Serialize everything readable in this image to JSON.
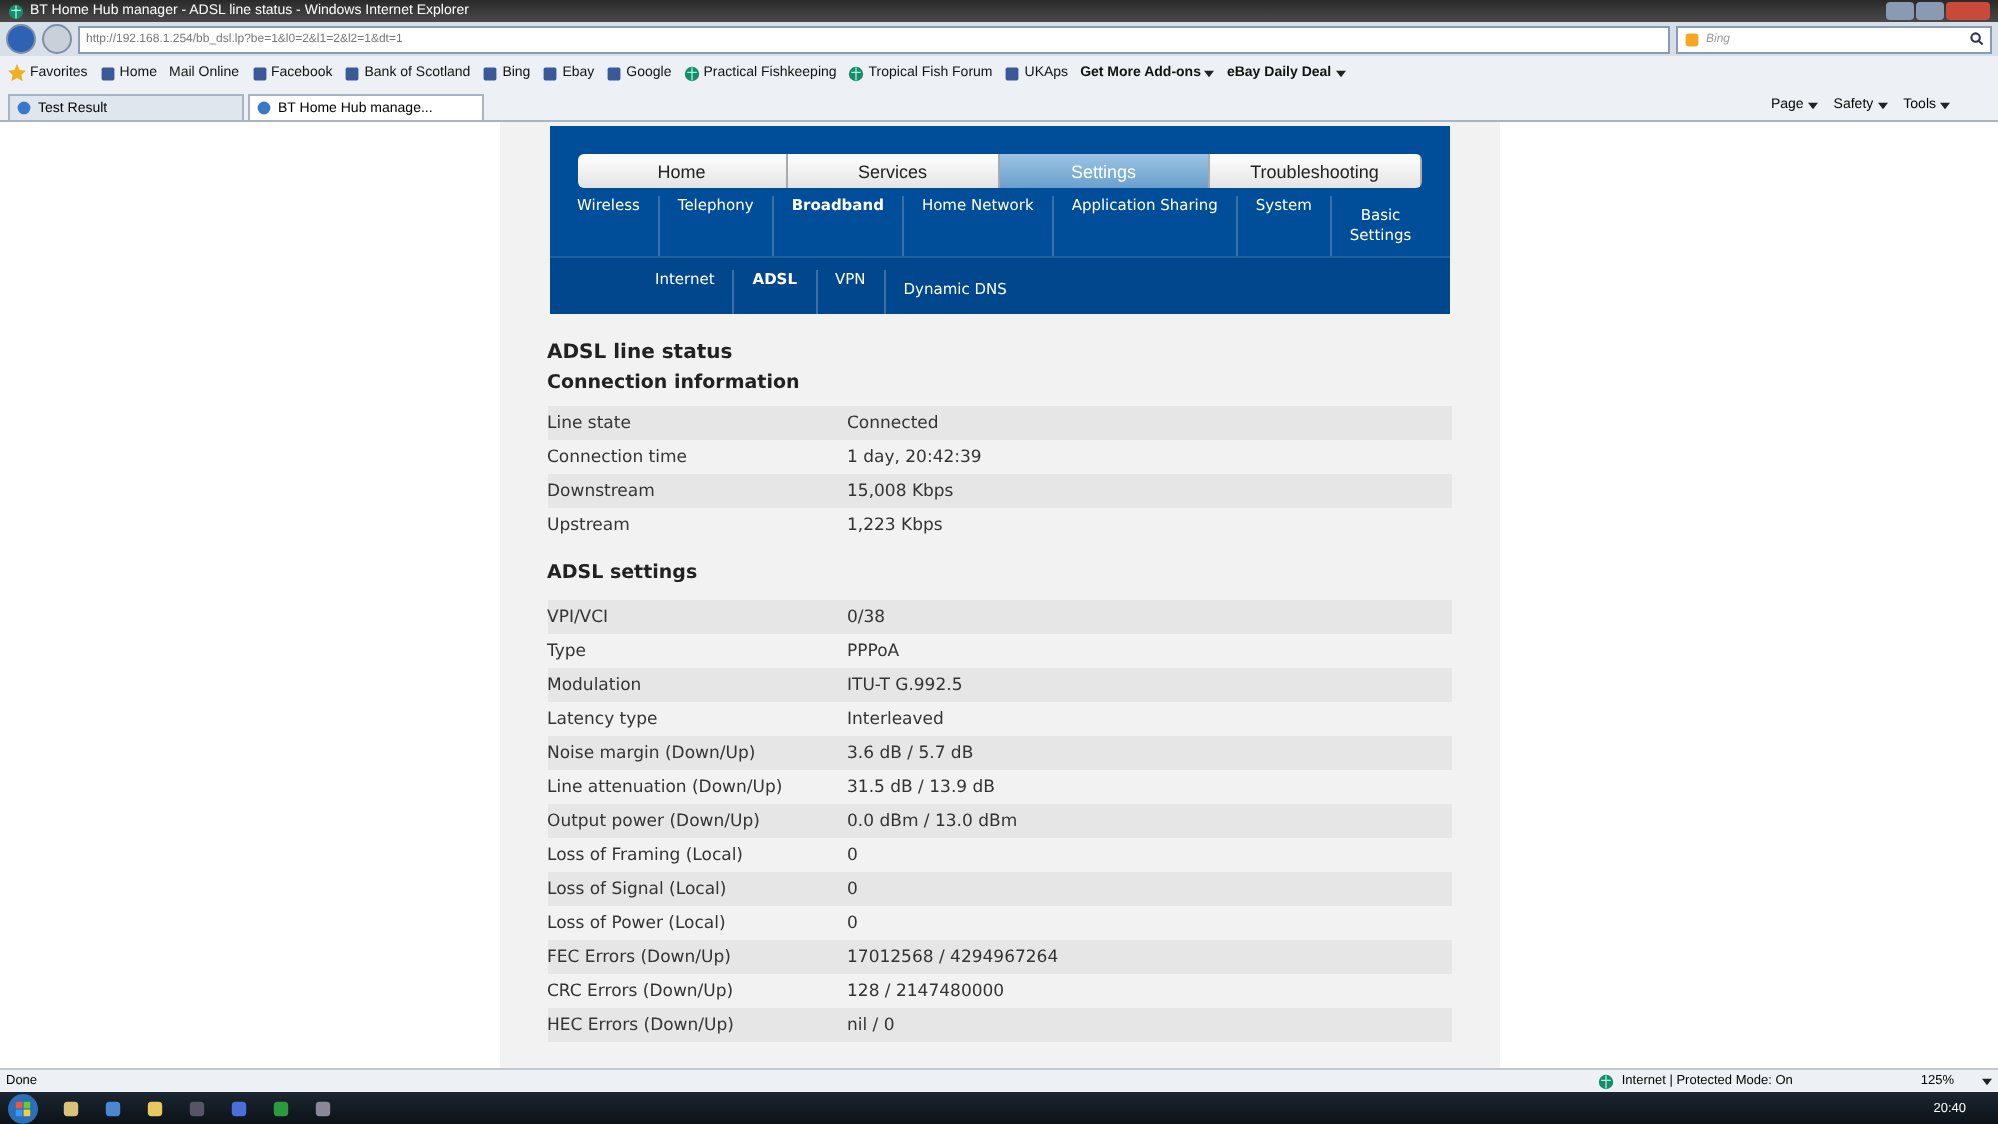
{
  "window": {
    "title": "BT Home Hub manager - ADSL line status - Windows Internet Explorer"
  },
  "address_bar": {
    "url": "http://192.168.1.254/bb_dsl.lp?be=1&l0=2&l1=2&l2=1&dt=1"
  },
  "search": {
    "placeholder": "Bing"
  },
  "favorites_bar": {
    "label": "Favorites",
    "items": [
      {
        "label": "Home",
        "kind": "page"
      },
      {
        "label": "Mail Online",
        "kind": "plain"
      },
      {
        "label": "Facebook",
        "kind": "page"
      },
      {
        "label": "Bank of Scotland",
        "kind": "page"
      },
      {
        "label": "Bing",
        "kind": "page"
      },
      {
        "label": "Ebay",
        "kind": "page"
      },
      {
        "label": "Google",
        "kind": "page"
      },
      {
        "label": "Practical Fishkeeping",
        "kind": "globe"
      },
      {
        "label": "Tropical Fish Forum",
        "kind": "globe"
      },
      {
        "label": "UKAps",
        "kind": "page"
      },
      {
        "label": "Get More Add-ons",
        "kind": "menu"
      },
      {
        "label": "eBay Daily Deal",
        "kind": "menu"
      }
    ]
  },
  "tabs": [
    {
      "label": "Test Result",
      "selected": false
    },
    {
      "label": "BT Home Hub manage...",
      "selected": true
    }
  ],
  "command_bar": [
    "Page",
    "Safety",
    "Tools"
  ],
  "nav": {
    "main": [
      {
        "label": "Home",
        "selected": false
      },
      {
        "label": "Services",
        "selected": false
      },
      {
        "label": "Settings",
        "selected": true
      },
      {
        "label": "Troubleshooting",
        "selected": false
      }
    ],
    "sub": [
      {
        "label": "Wireless",
        "selected": false
      },
      {
        "label": "Telephony",
        "selected": false
      },
      {
        "label": "Broadband",
        "selected": true
      },
      {
        "label": "Home Network",
        "selected": false
      },
      {
        "label": "Application Sharing",
        "selected": false
      },
      {
        "label": "System",
        "selected": false
      },
      {
        "label": "Basic Settings",
        "selected": false
      }
    ],
    "subsub": [
      {
        "label": "Internet",
        "selected": false
      },
      {
        "label": "ADSL",
        "selected": true
      },
      {
        "label": "VPN",
        "selected": false
      },
      {
        "label": "Dynamic DNS",
        "selected": false
      }
    ]
  },
  "page_title": "ADSL line status",
  "sections": [
    {
      "title": "Connection information",
      "rows": [
        [
          "Line state",
          "Connected"
        ],
        [
          "Connection time",
          "1 day, 20:42:39"
        ],
        [
          "Downstream",
          "15,008 Kbps"
        ],
        [
          "Upstream",
          "1,223 Kbps"
        ]
      ]
    },
    {
      "title": "ADSL settings",
      "rows": [
        [
          "VPI/VCI",
          "0/38"
        ],
        [
          "Type",
          "PPPoA"
        ],
        [
          "Modulation",
          "ITU-T G.992.5"
        ],
        [
          "Latency type",
          "Interleaved"
        ],
        [
          "Noise margin (Down/Up)",
          "3.6 dB / 5.7 dB"
        ],
        [
          "Line attenuation (Down/Up)",
          "31.5 dB / 13.9 dB"
        ],
        [
          "Output power (Down/Up)",
          "0.0 dBm / 13.0 dBm"
        ],
        [
          "Loss of Framing (Local)",
          "0"
        ],
        [
          "Loss of Signal (Local)",
          "0"
        ],
        [
          "Loss of Power (Local)",
          "0"
        ],
        [
          "FEC Errors (Down/Up)",
          "17012568 / 4294967264"
        ],
        [
          "CRC Errors (Down/Up)",
          "128 / 2147480000"
        ],
        [
          "HEC Errors (Down/Up)",
          "nil / 0"
        ]
      ]
    }
  ],
  "status_bar": {
    "text": "Done",
    "zone": "Internet | Protected Mode: On",
    "zoom": "125%"
  },
  "taskbar": {
    "clock": "20:40"
  }
}
